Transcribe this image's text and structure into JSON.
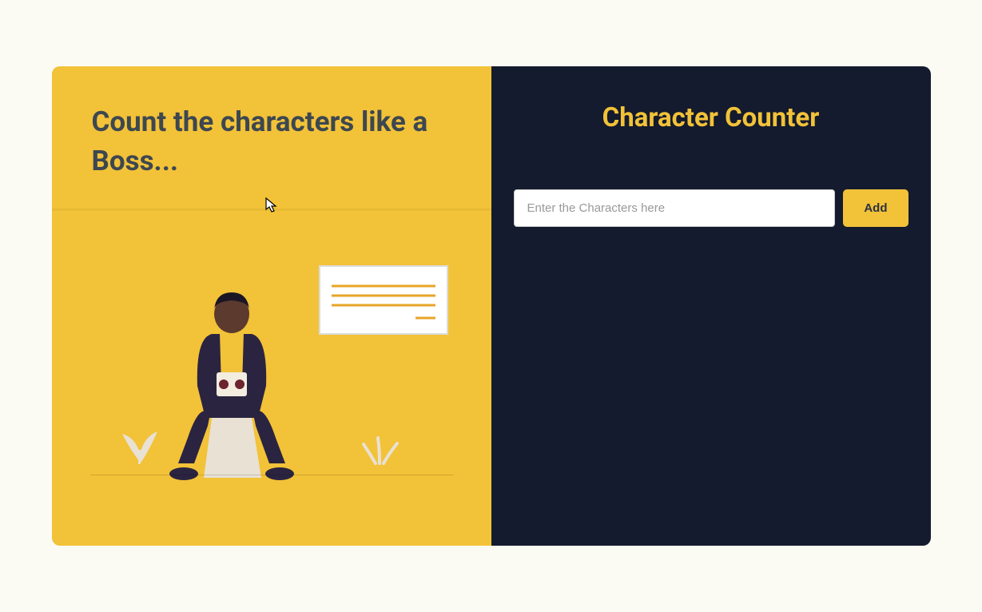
{
  "left": {
    "heading": "Count the characters like a Boss..."
  },
  "right": {
    "title": "Character Counter",
    "input": {
      "value": "",
      "placeholder": "Enter the Characters here"
    },
    "add_label": "Add"
  },
  "colors": {
    "accent": "#f2c238",
    "dark": "#141b2e",
    "background": "#fcfbf3"
  }
}
